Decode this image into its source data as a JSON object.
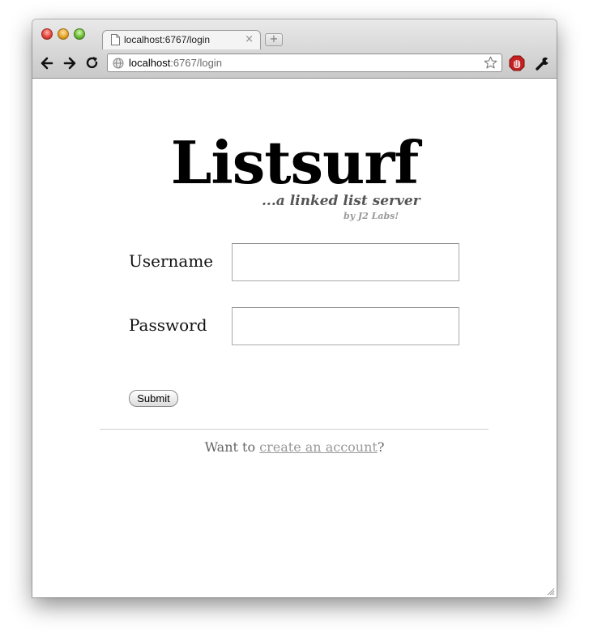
{
  "browser": {
    "tab_title": "localhost:6767/login",
    "new_tab_glyph": "+",
    "tab_close_glyph": "×",
    "url_host": "localhost",
    "url_rest": ":6767/login",
    "icons": [
      "back-icon",
      "forward-icon",
      "reload-icon",
      "globe-icon",
      "bookmark-star-icon",
      "stop-extension-icon",
      "wrench-icon"
    ]
  },
  "page": {
    "logo": "Listsurf",
    "tagline": "...a linked list server",
    "byline": "by J2 Labs!",
    "form": {
      "username_label": "Username",
      "username_value": "",
      "password_label": "Password",
      "password_value": "",
      "submit_label": "Submit"
    },
    "signup": {
      "prefix": "Want to ",
      "link_text": "create an account",
      "suffix": "?"
    }
  },
  "colors": {
    "tagline": "#555555",
    "byline": "#999999",
    "link": "#999999",
    "text_muted": "#666666"
  }
}
